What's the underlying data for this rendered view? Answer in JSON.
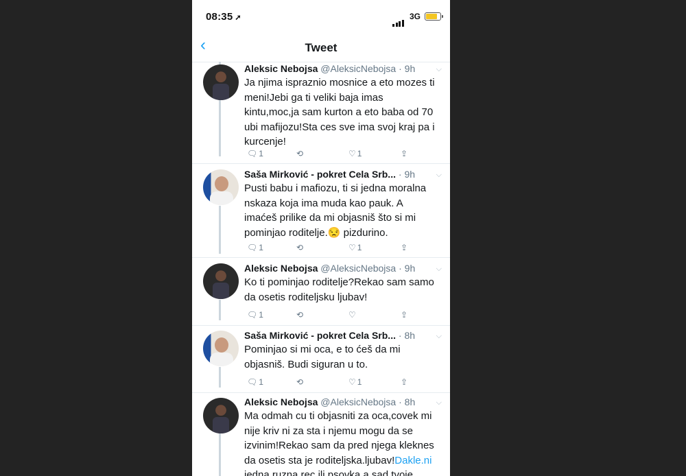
{
  "status": {
    "time": "08:35",
    "network": "3G"
  },
  "nav": {
    "title": "Tweet"
  },
  "tweets": [
    {
      "name": "Aleksic Nebojsa",
      "handle": "@AleksicNebojsa",
      "time": "9h",
      "lines": [
        "Ja njima ispraznio mosnice a eto mozes ti",
        "meni!Jebi ga ti veliki baja imas",
        "kintu,moc,ja sam kurton a eto baba od 70",
        "ubi mafijozu!Sta ces sve ima svoj kraj pa i",
        "kurcenje!"
      ],
      "replies": "1",
      "likes": "1"
    },
    {
      "name": "Saša Mirković - pokret Cela Srb...",
      "handle": "",
      "time": "9h",
      "lines": [
        "Pusti babu i mafiozu, ti si jedna moralna",
        "nskaza koja ima muda kao pauk. A",
        "imaćeš prilike da mi objasniš što si mi",
        "pominjao roditelje.",
        "pizdurino."
      ],
      "emoji": "😒",
      "replies": "1",
      "likes": "1"
    },
    {
      "name": "Aleksic Nebojsa",
      "handle": "@AleksicNebojsa",
      "time": "9h",
      "lines": [
        "Ko ti pominjao roditelje?Rekao sam samo",
        "da osetis roditeljsku ljubav!"
      ],
      "replies": "1",
      "likes": ""
    },
    {
      "name": "Saša Mirković - pokret Cela Srb...",
      "handle": "",
      "time": "8h",
      "lines": [
        "Pominjao si mi oca, e to ćeš da mi",
        "objasniš. Budi siguran u to."
      ],
      "replies": "1",
      "likes": "1"
    },
    {
      "name": "Aleksic Nebojsa",
      "handle": "@AleksicNebojsa",
      "time": "8h",
      "lines": [
        "Ma odmah cu ti objasniti za oca,covek mi",
        "nije kriv ni za sta i njemu mogu da se",
        "izvinim!Rekao sam da pred njega kleknes",
        "da osetis sta je roditeljska.ljubav!",
        "jedna ruzna rec ili psovka a sad tvoje"
      ],
      "link": "Dakle.ni"
    }
  ],
  "icons": {
    "back": "chevron-left-icon",
    "location": "location-arrow-icon",
    "reply": "reply-icon",
    "retweet": "retweet-icon",
    "like": "heart-icon",
    "share": "share-icon",
    "menu": "chevron-down-icon"
  },
  "colors": {
    "accent": "#1da1f2",
    "battery": "#f3c623",
    "text": "#14171a",
    "secondary": "#657786"
  }
}
